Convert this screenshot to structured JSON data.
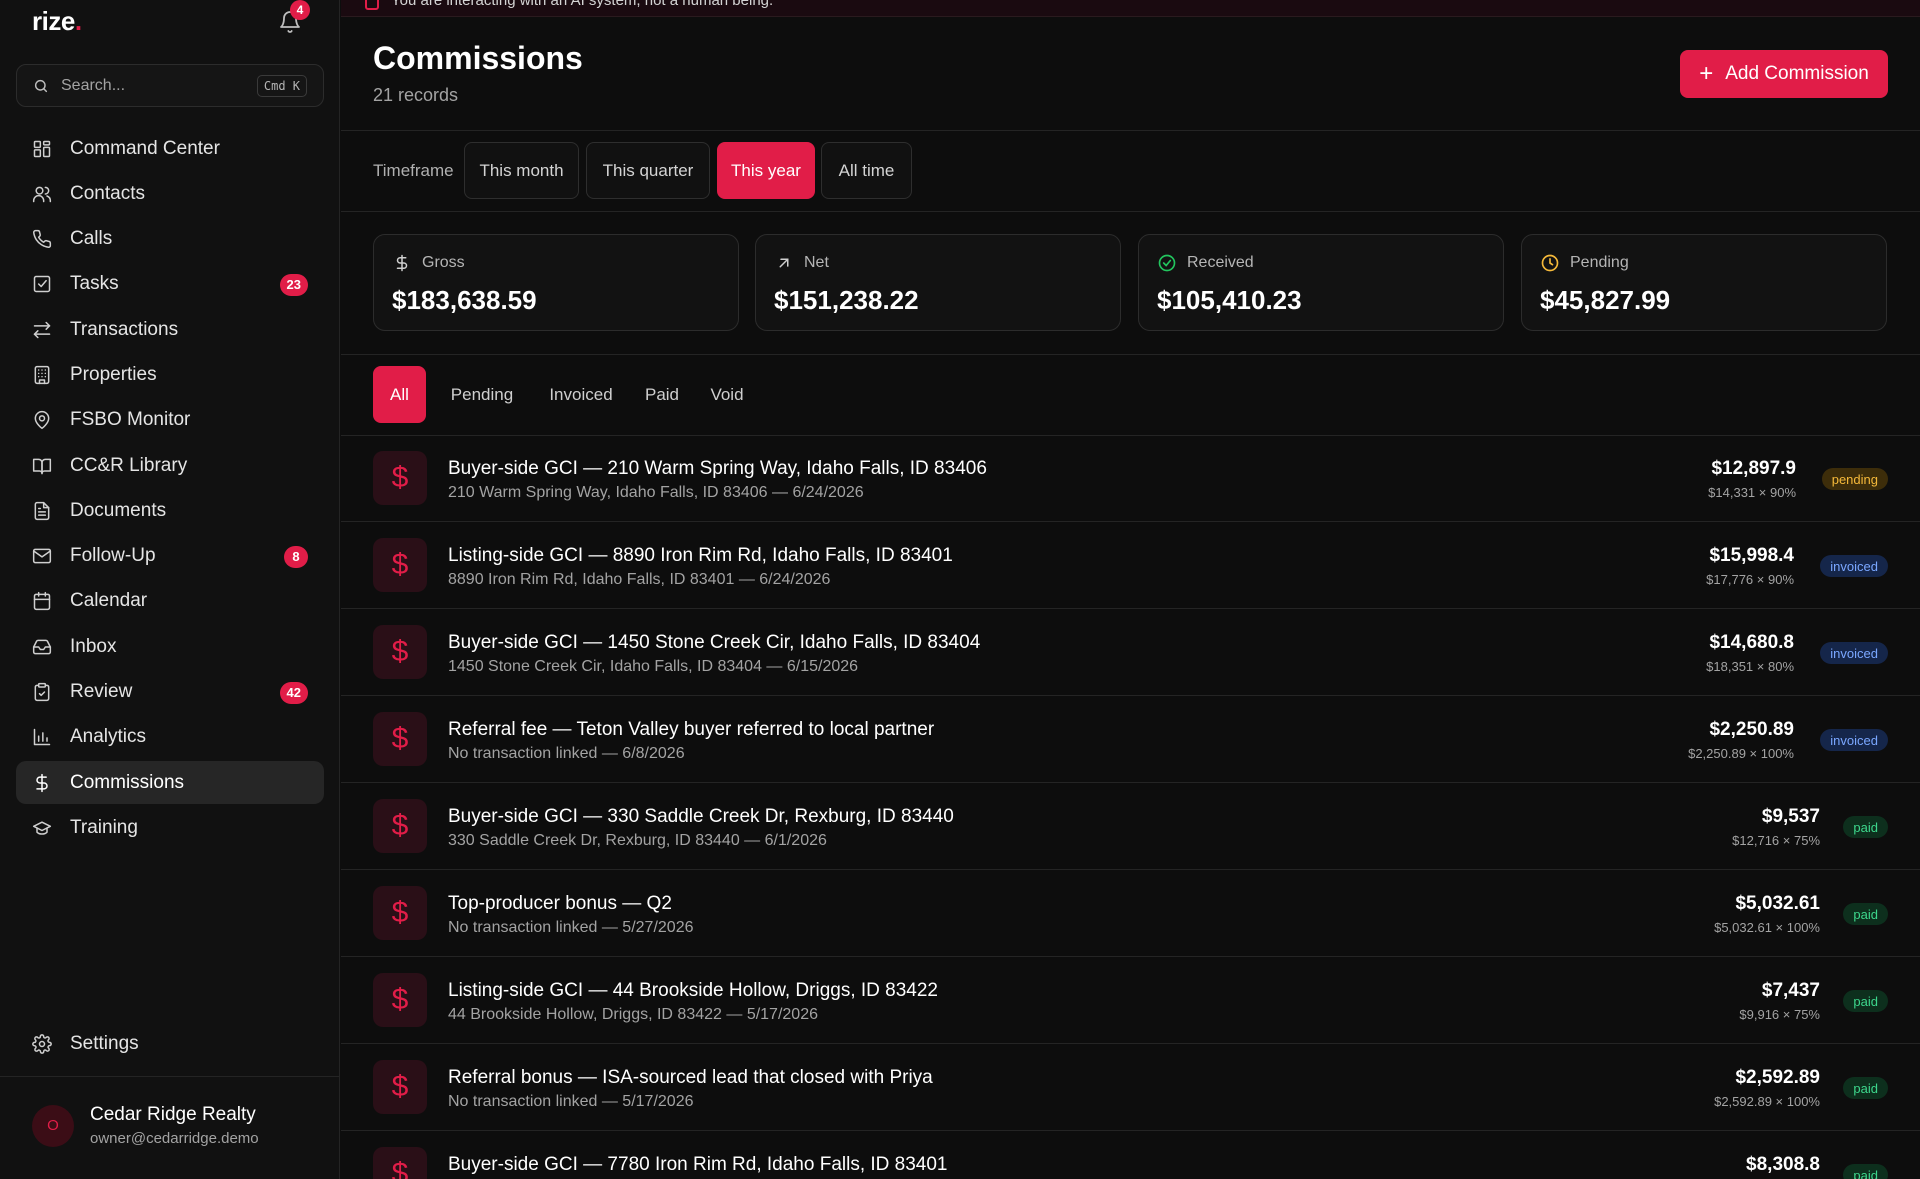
{
  "app": {
    "logo_text": "rize",
    "logo_dot": ".",
    "notification_count": "4"
  },
  "search": {
    "placeholder": "Search...",
    "shortcut": "Cmd K"
  },
  "nav": [
    {
      "label": "Command Center",
      "icon": "grid-icon"
    },
    {
      "label": "Contacts",
      "icon": "users-icon"
    },
    {
      "label": "Calls",
      "icon": "phone-icon"
    },
    {
      "label": "Tasks",
      "icon": "checkbox-icon",
      "badge": "23"
    },
    {
      "label": "Transactions",
      "icon": "arrows-icon"
    },
    {
      "label": "Properties",
      "icon": "building-icon"
    },
    {
      "label": "FSBO Monitor",
      "icon": "map-pin-icon"
    },
    {
      "label": "CC&R Library",
      "icon": "book-icon"
    },
    {
      "label": "Documents",
      "icon": "document-icon"
    },
    {
      "label": "Follow-Up",
      "icon": "mail-icon",
      "badge": "8"
    },
    {
      "label": "Calendar",
      "icon": "calendar-icon"
    },
    {
      "label": "Inbox",
      "icon": "inbox-icon"
    },
    {
      "label": "Review",
      "icon": "clipboard-icon",
      "badge": "42"
    },
    {
      "label": "Analytics",
      "icon": "bar-chart-icon"
    },
    {
      "label": "Commissions",
      "icon": "dollar-icon",
      "active": true
    },
    {
      "label": "Training",
      "icon": "graduation-cap-icon"
    }
  ],
  "settings": {
    "label": "Settings"
  },
  "user": {
    "initial": "O",
    "name": "Cedar Ridge Realty",
    "email": "owner@cedarridge.demo"
  },
  "banner": {
    "text": "You are interacting with an AI system, not a human being."
  },
  "header": {
    "title": "Commissions",
    "subtitle": "21 records",
    "add_label": "Add Commission"
  },
  "timeframe": {
    "label": "Timeframe",
    "options": [
      "This month",
      "This quarter",
      "This year",
      "All time"
    ],
    "selected": "This year"
  },
  "stats": [
    {
      "label": "Gross",
      "value": "$183,638.59",
      "icon": "dollar-icon"
    },
    {
      "label": "Net",
      "value": "$151,238.22",
      "icon": "arrow-up-right-icon"
    },
    {
      "label": "Received",
      "value": "$105,410.23",
      "icon": "check-circle-icon",
      "color": "#22c55e"
    },
    {
      "label": "Pending",
      "value": "$45,827.99",
      "icon": "clock-icon",
      "color": "#f5b93a"
    }
  ],
  "filters": {
    "tabs": [
      "All",
      "Pending",
      "Invoiced",
      "Paid",
      "Void"
    ],
    "selected": "All"
  },
  "commissions": [
    {
      "title": "Buyer-side GCI — 210 Warm Spring Way, Idaho Falls, ID 83406",
      "subtitle": "210 Warm Spring Way, Idaho Falls, ID 83406 — 6/24/2026",
      "amount": "$12,897.9",
      "calc": "$14,331 × 90%",
      "status": "pending"
    },
    {
      "title": "Listing-side GCI — 8890 Iron Rim Rd, Idaho Falls, ID 83401",
      "subtitle": "8890 Iron Rim Rd, Idaho Falls, ID 83401 — 6/24/2026",
      "amount": "$15,998.4",
      "calc": "$17,776 × 90%",
      "status": "invoiced"
    },
    {
      "title": "Buyer-side GCI — 1450 Stone Creek Cir, Idaho Falls, ID 83404",
      "subtitle": "1450 Stone Creek Cir, Idaho Falls, ID 83404 — 6/15/2026",
      "amount": "$14,680.8",
      "calc": "$18,351 × 80%",
      "status": "invoiced"
    },
    {
      "title": "Referral fee — Teton Valley buyer referred to local partner",
      "subtitle": "No transaction linked — 6/8/2026",
      "amount": "$2,250.89",
      "calc": "$2,250.89 × 100%",
      "status": "invoiced"
    },
    {
      "title": "Buyer-side GCI — 330 Saddle Creek Dr, Rexburg, ID 83440",
      "subtitle": "330 Saddle Creek Dr, Rexburg, ID 83440 — 6/1/2026",
      "amount": "$9,537",
      "calc": "$12,716 × 75%",
      "status": "paid"
    },
    {
      "title": "Top-producer bonus — Q2",
      "subtitle": "No transaction linked — 5/27/2026",
      "amount": "$5,032.61",
      "calc": "$5,032.61 × 100%",
      "status": "paid"
    },
    {
      "title": "Listing-side GCI — 44 Brookside Hollow, Driggs, ID 83422",
      "subtitle": "44 Brookside Hollow, Driggs, ID 83422 — 5/17/2026",
      "amount": "$7,437",
      "calc": "$9,916 × 75%",
      "status": "paid"
    },
    {
      "title": "Referral bonus — ISA-sourced lead that closed with Priya",
      "subtitle": "No transaction linked — 5/17/2026",
      "amount": "$2,592.89",
      "calc": "$2,592.89 × 100%",
      "status": "paid"
    },
    {
      "title": "Buyer-side GCI — 7780 Iron Rim Rd, Idaho Falls, ID 83401",
      "subtitle": "",
      "amount": "$8,308.8",
      "calc": "",
      "status": "paid"
    }
  ],
  "colors": {
    "accent": "#e11d48",
    "background": "#0d0d0d",
    "sidebar": "#111111"
  }
}
